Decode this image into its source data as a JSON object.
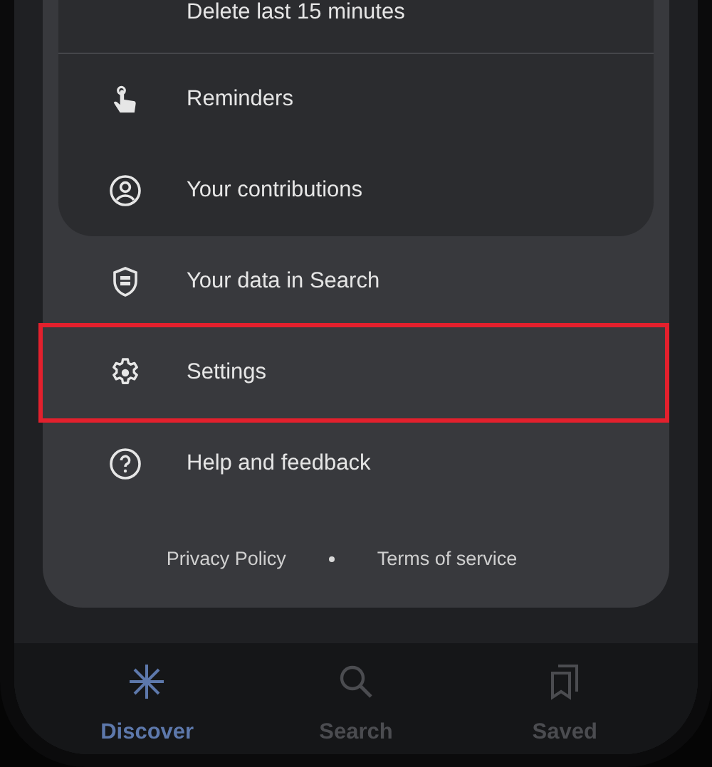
{
  "card_items": [
    {
      "label": "Delete last 15 minutes",
      "kind": "plain",
      "highlighted": false
    },
    {
      "label": "Reminders",
      "kind": "hand",
      "highlighted": false
    },
    {
      "label": "Your contributions",
      "kind": "account",
      "highlighted": false
    }
  ],
  "menu_items": [
    {
      "label": "Your data in Search",
      "kind": "shield",
      "highlighted": false
    },
    {
      "label": "Settings",
      "kind": "gear",
      "highlighted": true
    },
    {
      "label": "Help and feedback",
      "kind": "help",
      "highlighted": false
    }
  ],
  "footer_links": [
    "Privacy Policy",
    "Terms of service"
  ],
  "bottom_nav": [
    {
      "label": "Discover",
      "kind": "sparkle",
      "selected": true
    },
    {
      "label": "Search",
      "kind": "search",
      "selected": false
    },
    {
      "label": "Saved",
      "kind": "bookmarks",
      "selected": false
    }
  ]
}
